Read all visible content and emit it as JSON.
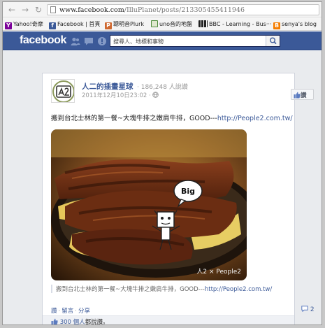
{
  "browser": {
    "url_host": "www.facebook.com",
    "url_path": "/IlluPlanet/posts/213305455411946"
  },
  "bookmarks": [
    {
      "label": "Yahoo!奇摩",
      "icon": "yahoo-icon",
      "color": "#7b0099"
    },
    {
      "label": "Facebook | 首頁",
      "icon": "facebook-icon",
      "color": "#3b5998"
    },
    {
      "label": "聰明音Plurk",
      "icon": "plurk-icon",
      "color": "#cf682f"
    },
    {
      "label": "uno音的地盤",
      "icon": "blog-icon",
      "color": "#4a8a3a"
    },
    {
      "label": "BBC - Learning - Bus···",
      "icon": "bbc-icon",
      "color": "#222222"
    },
    {
      "label": "senya's blog",
      "icon": "blogger-icon",
      "color": "#f57d00"
    }
  ],
  "facebook": {
    "logo": "facebook",
    "brand_color": "#3b5998",
    "search_placeholder": "搜尋人、地標和事物"
  },
  "post": {
    "page_name": "人二的插畫星球",
    "likes_count": "· 186,248 人說讚",
    "timestamp": "2011年12月10日23:02 · ",
    "like_button": "讚",
    "message_text": "搬到台北士林的第一餐~大塊牛排之嫩肩牛排，GOOD---",
    "message_link": "http://People2.com.tw/",
    "photo_speech_bubble": "Big",
    "photo_watermark": "人2 × People2",
    "caption_text": "搬到台北士林的第一餐~大塊牛排之嫩肩牛排，GOOD---",
    "caption_link": "http://People2.com.tw/",
    "actions": [
      "讚",
      "留言",
      "分享"
    ],
    "comment_count": "2",
    "likes_summary_count": "300 個人",
    "likes_summary_suffix": "都說讚。"
  }
}
